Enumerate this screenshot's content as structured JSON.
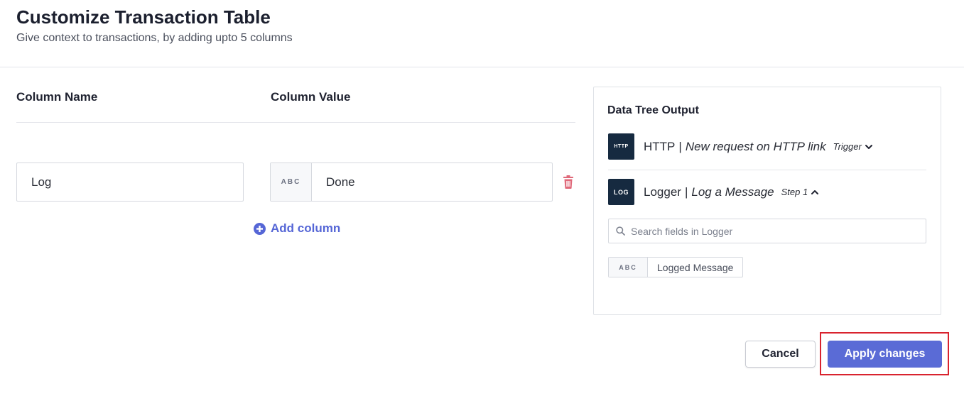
{
  "header": {
    "title": "Customize Transaction Table",
    "subtitle": "Give context to transactions, by adding upto 5 columns"
  },
  "columns_editor": {
    "name_header": "Column Name",
    "value_header": "Column Value",
    "rows": [
      {
        "name": "Log",
        "value_type": "ABC",
        "value": "Done"
      }
    ],
    "add_column_label": "Add column"
  },
  "data_tree": {
    "title": "Data Tree Output",
    "steps": [
      {
        "logo": "HTTP",
        "app": "HTTP",
        "separator": "|",
        "event": "New request on HTTP link",
        "tag": "Trigger",
        "expanded": false
      },
      {
        "logo": "LOG",
        "app": "Logger",
        "separator": "|",
        "event": "Log a Message",
        "tag": "Step 1",
        "expanded": true
      }
    ],
    "search_placeholder": "Search fields in Logger",
    "fields": [
      {
        "type": "ABC",
        "label": "Logged Message"
      }
    ]
  },
  "footer": {
    "cancel_label": "Cancel",
    "apply_label": "Apply changes"
  },
  "colors": {
    "accent": "#5a6bd6",
    "highlight": "#d9232e",
    "delete": "#e0697a",
    "logo_bg": "#162a40"
  },
  "icons": {
    "delete": "trash-icon",
    "add": "plus-circle-icon",
    "search": "search-icon",
    "collapsed": "chevron-down-icon",
    "expanded": "chevron-up-icon"
  }
}
